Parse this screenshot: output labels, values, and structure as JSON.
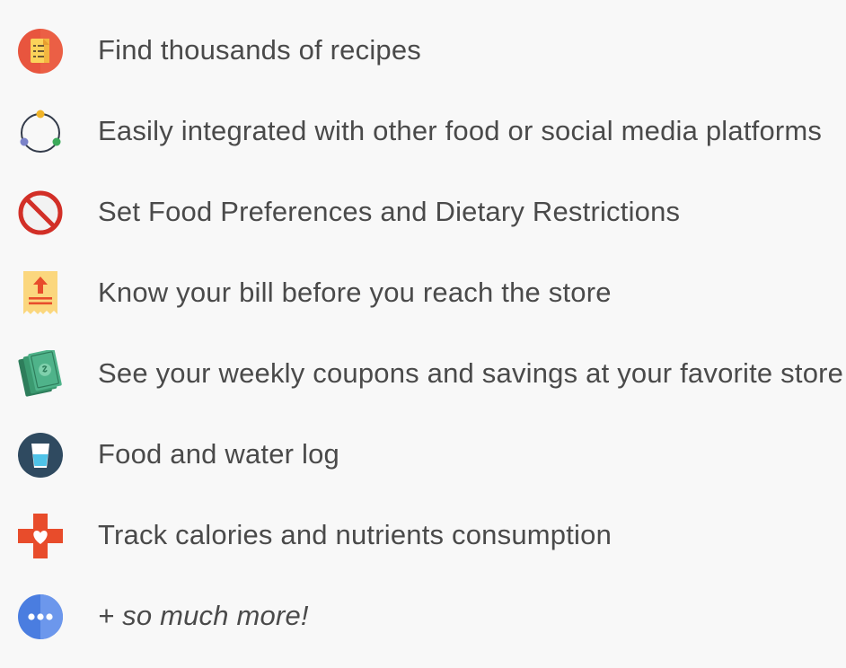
{
  "features": [
    {
      "icon": "recipe-document-icon",
      "label": "Find thousands of recipes"
    },
    {
      "icon": "integration-cycle-icon",
      "label": "Easily integrated with other food or social media platforms"
    },
    {
      "icon": "prohibited-icon",
      "label": "Set Food Preferences and Dietary Restrictions"
    },
    {
      "icon": "receipt-icon",
      "label": "Know your bill before you reach the store"
    },
    {
      "icon": "money-bills-icon",
      "label": "See your weekly coupons and savings at your favorite store"
    },
    {
      "icon": "water-glass-icon",
      "label": "Food and water log"
    },
    {
      "icon": "health-cross-heart-icon",
      "label": "Track calories and nutrients consumption"
    },
    {
      "icon": "more-dots-icon",
      "label": "+ so much more!"
    }
  ],
  "colors": {
    "background": "#f8f8f8",
    "text": "#4a4a4a",
    "recipe_icon_bg": "#e8553e",
    "prohibited_icon": "#d22f27",
    "water_icon_bg": "#2f4a60",
    "health_cross": "#e84c2b",
    "more_icon_bg": "#4a7de0"
  }
}
